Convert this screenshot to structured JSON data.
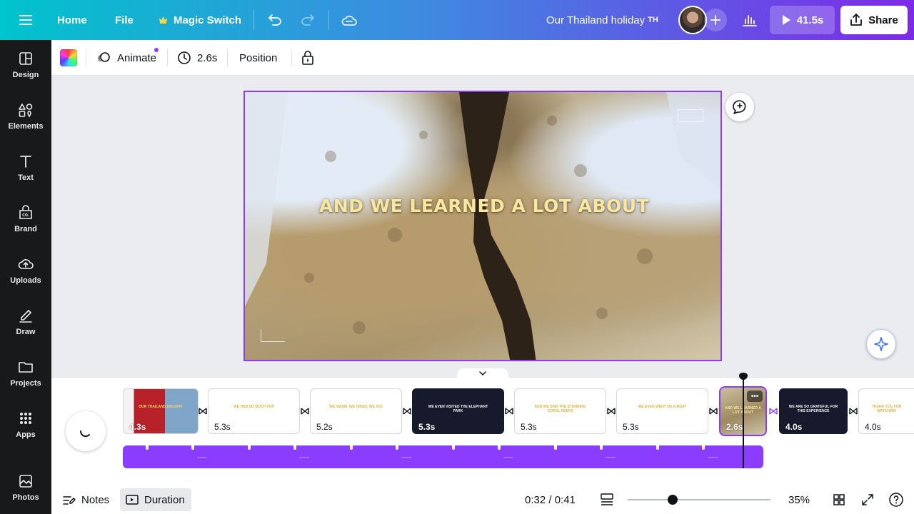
{
  "topbar": {
    "home": "Home",
    "file": "File",
    "magic_switch": "Magic Switch",
    "doc_title": "Our Thailand holiday",
    "doc_title_flag": "TH",
    "play_time": "41.5s",
    "share": "Share"
  },
  "sidebar": {
    "items": [
      {
        "label": "Design",
        "icon": "design-icon"
      },
      {
        "label": "Elements",
        "icon": "elements-icon"
      },
      {
        "label": "Text",
        "icon": "text-icon"
      },
      {
        "label": "Brand",
        "icon": "brand-icon"
      },
      {
        "label": "Uploads",
        "icon": "uploads-icon"
      },
      {
        "label": "Draw",
        "icon": "draw-icon"
      },
      {
        "label": "Projects",
        "icon": "projects-icon"
      },
      {
        "label": "Apps",
        "icon": "apps-icon"
      },
      {
        "label": "Photos",
        "icon": "photos-icon"
      }
    ]
  },
  "toolbar": {
    "animate": "Animate",
    "duration": "2.6s",
    "position": "Position"
  },
  "slide": {
    "caption": "AND WE LEARNED A LOT ABOUT"
  },
  "timeline": {
    "clips": [
      {
        "duration": "4.3s",
        "caption": "OUR THAILAND HOLIDAY",
        "style": "photo-red"
      },
      {
        "duration": "5.3s",
        "caption": "WE HAD SO MUCH FUN",
        "style": "light"
      },
      {
        "duration": "5.2s",
        "caption": "WE SWAM, WE HIKED, WE ATE",
        "style": "light"
      },
      {
        "duration": "5.3s",
        "caption": "WE EVEN VISITED THE ELEPHANT PARK",
        "style": "dark"
      },
      {
        "duration": "5.3s",
        "caption": "AND WE SAW THE STUNNING CORAL REEFS",
        "style": "light"
      },
      {
        "duration": "5.3s",
        "caption": "WE EVEN WENT ON A BOAT",
        "style": "light"
      },
      {
        "duration": "2.6s",
        "caption": "AND WE LEARNED A LOT ABOUT",
        "style": "photo-rock"
      },
      {
        "duration": "4.0s",
        "caption": "WE ARE SO GRATEFUL FOR THIS EXPERIENCE",
        "style": "dark"
      },
      {
        "duration": "4.0s",
        "caption": "THANK YOU FOR WATCHING",
        "style": "light"
      }
    ],
    "selected_index": 6
  },
  "bottombar": {
    "notes": "Notes",
    "duration": "Duration",
    "time": "0:32 / 0:41",
    "zoom": "35%"
  },
  "colors": {
    "accent": "#8b3dff",
    "sidebar_bg": "#18191b",
    "topbar_gradient_start": "#00c4cc",
    "topbar_gradient_end": "#7d2ae8"
  }
}
